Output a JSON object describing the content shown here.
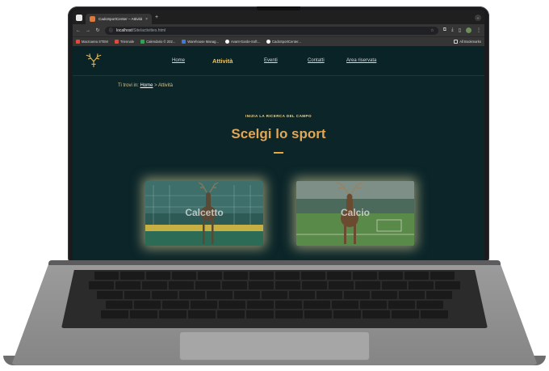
{
  "browser": {
    "tab_title": "CadoSportCenter – Attività",
    "tab_close": "×",
    "new_tab": "+",
    "url_host": "localhost",
    "url_path": "/Site/activities.html",
    "bookmarks": [
      {
        "label": "Macroarea STEM",
        "color": "#e04a3a"
      },
      {
        "label": "Triennale",
        "color": "#e04a3a"
      },
      {
        "label": "Calendario © 202...",
        "color": "#2fa44f"
      },
      {
        "label": "Warehouse Manag...",
        "color": "#3a7be0"
      },
      {
        "label": "Avant-Garde-Soft...",
        "color": "#ffffff"
      },
      {
        "label": "CadoSportCenter...",
        "color": "#ffffff"
      }
    ],
    "all_bookmarks": "All Bookmarks"
  },
  "site": {
    "nav": {
      "home": "Home",
      "activities": "Attività",
      "events": "Eventi",
      "contacts": "Contatti",
      "reserved": "Area riservata"
    },
    "breadcrumb": {
      "prefix": "Ti trovi in: ",
      "home": "Home",
      "separator": " > ",
      "current": "Attività"
    },
    "eyebrow": "INIZIA LA RICERCA DEL CAMPO",
    "heading": "Scelgi lo sport",
    "cards": [
      {
        "label": "Calcetto"
      },
      {
        "label": "Calcio"
      }
    ],
    "colors": {
      "background": "#0b2529",
      "accent": "#e0a757",
      "nav_active": "#e8c46a"
    }
  }
}
